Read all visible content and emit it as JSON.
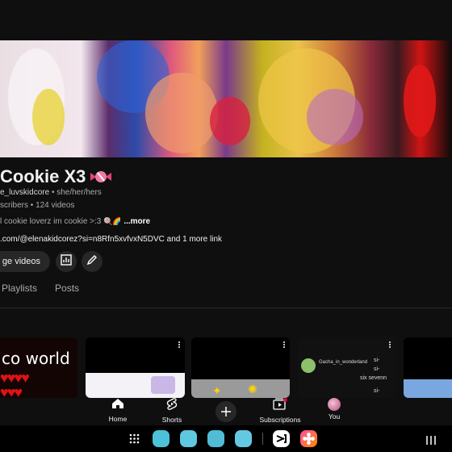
{
  "channel": {
    "name": "Cookie X3",
    "handle": "e_luvskidcore",
    "pronouns": "she/her/hers",
    "stats": "scribers • 124 videos",
    "description": "l cookie loverz im cookie >:3",
    "more": "...more",
    "link": ".com/@elenakidcorez?si=n8Rfn5xvfvxN5DVC",
    "link_more": "and 1 more link"
  },
  "actions": {
    "manage_label": "ge videos"
  },
  "tabs": [
    {
      "label": "Playlists"
    },
    {
      "label": "Posts"
    }
  ],
  "thumbnails": [
    {
      "text": "co world"
    },
    {
      "text": ""
    },
    {
      "text": ""
    },
    {
      "text_top": "Gacha_in_wonderland",
      "text_side1": "si-",
      "text_side2": "six sevenn",
      "text_side3": "si-",
      "text_side4": "si-"
    },
    {
      "text": ""
    }
  ],
  "bottom_nav": {
    "home": "Home",
    "shorts": "Shorts",
    "subscriptions": "Subscriptions",
    "you": "You"
  },
  "colors": {
    "background": "#0f0f0f",
    "chip": "#272727",
    "text": "#f1f1f1",
    "muted": "#aaaaaa"
  }
}
